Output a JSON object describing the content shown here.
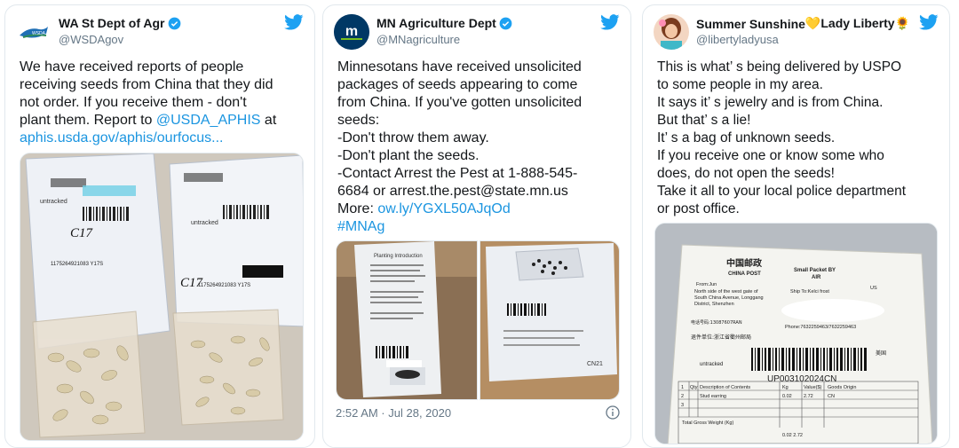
{
  "tweets": [
    {
      "display_name": "WA St Dept of Agr",
      "handle": "@WSDAgov",
      "text_lines": [
        "We have received reports of people",
        "receiving seeds from China that they did",
        "not order. If you receive them - don't",
        "plant them. Report to "
      ],
      "mention": "@USDA_APHIS",
      "after_mention": " at",
      "link": "aphis.usda.gov/aphis/ourfocus...",
      "photo": {
        "pkg1_text": "untracked",
        "pkg1_code": "1175264921083 Y17S",
        "pkg1_mark": "C17",
        "pkg2_text": "untracked",
        "pkg2_code": "1175264921083 Y17S",
        "pkg2_mark": "C17"
      }
    },
    {
      "display_name": "MN Agriculture Dept",
      "handle": "@MNagriculture",
      "avatar_text": "m",
      "text_lines": [
        "Minnesotans have received unsolicited",
        "packages of seeds appearing to come",
        "from China. If you've gotten unsolicited",
        "seeds:",
        "-Don't throw them away.",
        "-Don't plant the seeds.",
        "-Contact Arrest the Pest at 1-888-545-",
        "6684 or arrest.the.pest@state.mn.us",
        "More: "
      ],
      "link": "ow.ly/YGXL50AJqOd",
      "hashtag": "#MNAg",
      "timestamp": "2:52 AM · Jul 28, 2020",
      "photo": {
        "left_title": "Planting Introduction",
        "right_code": "CN21"
      }
    },
    {
      "display_name": "Summer Sunshine",
      "name_emoji": "💛Lady Liberty🌻",
      "handle": "@libertyladyusa",
      "text_lines": [
        "This is what’ s being delivered by USPO",
        "to some people in my area.",
        "It says it’ s jewelry and is from China.",
        "But that’ s a lie!",
        "It’ s a bag of unknown seeds.",
        "If you receive one or know some who",
        "does, do not open the seeds!",
        "Take it all to your local police department",
        "or post office."
      ],
      "photo": {
        "brand_cn": "中国邮政",
        "brand_en": "CHINA POST",
        "small_packet": "Small Packet BY",
        "air": "AIR",
        "from": "From:Jun",
        "ship_to": "Ship To:Kelci frost",
        "country": "US",
        "addr1": "North side of the west gate of",
        "addr2": "South China Avenue, Longgang",
        "addr3": "District, Shenzhen",
        "phone_label": "Phone:7632259463/7632259463",
        "tel": "电话号码:13087607RAN",
        "unit": "退件单位:浙江省衢州邮局",
        "untracked": "untracked",
        "barcode": "UP003102024CN",
        "usa": "美国",
        "qty": "Qty",
        "desc": "Description of Contents",
        "kg": "Kg",
        "value": "Value($)",
        "goods_origin": "Goods Origin",
        "stud": "Stud earring",
        "weight": "0.02",
        "val": "2.72",
        "cn": "CN",
        "total_weight": "Total Gross Weight (Kg)",
        "total_val": "0.02  2.72",
        "row1": "1",
        "row2": "2",
        "row3": "3"
      }
    }
  ],
  "colors": {
    "link": "#1b95e0",
    "twitter_blue": "#1da1f2",
    "border": "#e1e8ed"
  },
  "icons": [
    "twitter-bird-icon",
    "verified-badge-icon",
    "info-icon"
  ]
}
